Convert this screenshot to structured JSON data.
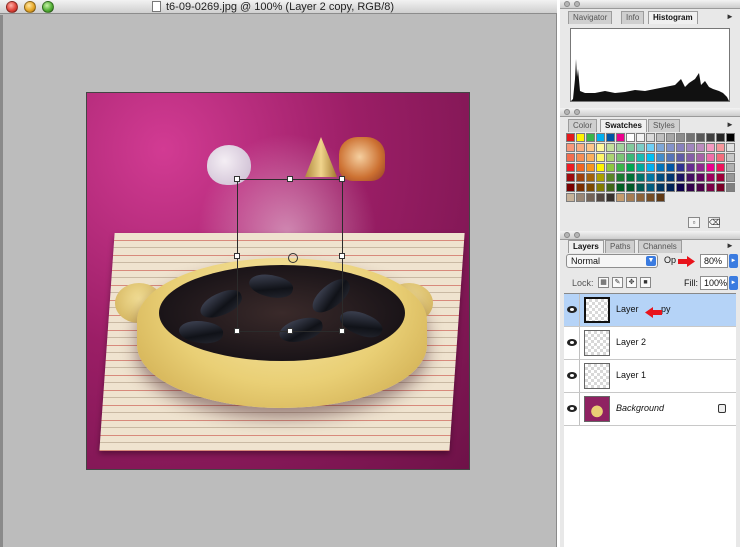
{
  "document": {
    "title": "t6-09-0269.jpg @ 100% (Layer 2 copy, RGB/8)"
  },
  "palettes": {
    "navigator_group": {
      "tabs": [
        "Navigator",
        "Info",
        "Histogram"
      ],
      "active_tab": "Histogram"
    },
    "color_group": {
      "tabs": [
        "Color",
        "Swatches",
        "Styles"
      ],
      "active_tab": "Swatches",
      "swatch_colors": [
        [
          "#e41a1c",
          "#fff200",
          "#39b54a",
          "#00aeef",
          "#0054a6",
          "#ec008c",
          "#ffffff",
          "#f2f2f2",
          "#d9d9d9",
          "#bfbfbf",
          "#a6a6a6",
          "#8c8c8c",
          "#737373",
          "#595959",
          "#404040",
          "#262626",
          "#000000"
        ],
        [
          "#f7977a",
          "#f9ad81",
          "#fdc68a",
          "#fff79a",
          "#c4df9b",
          "#a2d39c",
          "#82ca9d",
          "#7bcdc8",
          "#6ecff6",
          "#7ea7d8",
          "#8493ca",
          "#8882be",
          "#a187be",
          "#bc8dbf",
          "#f49ac2",
          "#f6989d",
          "#e0e0e0"
        ],
        [
          "#f26c4f",
          "#f68e55",
          "#fbaf5c",
          "#fff467",
          "#acd372",
          "#7cc576",
          "#3bb878",
          "#1abbb4",
          "#00bff3",
          "#438ccb",
          "#5574b9",
          "#605ca8",
          "#855fa8",
          "#a763a8",
          "#f06ea9",
          "#f26d7d",
          "#c8c8c8"
        ],
        [
          "#ed1c24",
          "#f26522",
          "#f7941d",
          "#fff200",
          "#8dc73f",
          "#39b54a",
          "#00a651",
          "#00a99d",
          "#00aeef",
          "#0072bc",
          "#0054a6",
          "#2e3192",
          "#662d91",
          "#92278f",
          "#ec008c",
          "#ed145b",
          "#b0b0b0"
        ],
        [
          "#9e0b0f",
          "#a0410d",
          "#a36209",
          "#aba000",
          "#598527",
          "#1a7b30",
          "#007236",
          "#00746b",
          "#0076a3",
          "#004b80",
          "#003471",
          "#1b1464",
          "#440e62",
          "#630460",
          "#9e005d",
          "#9e0039",
          "#989898"
        ],
        [
          "#790000",
          "#7b2e00",
          "#7d4900",
          "#827b00",
          "#406618",
          "#005e20",
          "#005826",
          "#005952",
          "#005b7f",
          "#003663",
          "#002157",
          "#0d004c",
          "#32004b",
          "#4b0049",
          "#7b0046",
          "#7a0026",
          "#808080"
        ],
        [
          "#c7b299",
          "#998675",
          "#736357",
          "#534741",
          "#37302d",
          "#c69c6d",
          "#a67c52",
          "#8c6239",
          "#754c24",
          "#603913"
        ]
      ]
    },
    "layers_group": {
      "tabs": [
        "Layers",
        "Paths",
        "Channels"
      ],
      "active_tab": "Layers",
      "blend_mode": "Normal",
      "opacity_label": "Op",
      "opacity_value": "80%",
      "lock_label": "Lock:",
      "fill_label": "Fill:",
      "fill_value": "100%",
      "layers": [
        {
          "name": "Layer 2 copy",
          "visible_name": "Layer ",
          "tail": "py",
          "selected": true
        },
        {
          "name": "Layer 2",
          "selected": false
        },
        {
          "name": "Layer 1",
          "selected": false
        },
        {
          "name": "Background",
          "selected": false,
          "locked": true
        }
      ]
    }
  },
  "colors": {
    "selection_blue": "#b5d3f7",
    "annotation_red": "#e8131b",
    "canvas_gray": "#bcbcbc"
  }
}
